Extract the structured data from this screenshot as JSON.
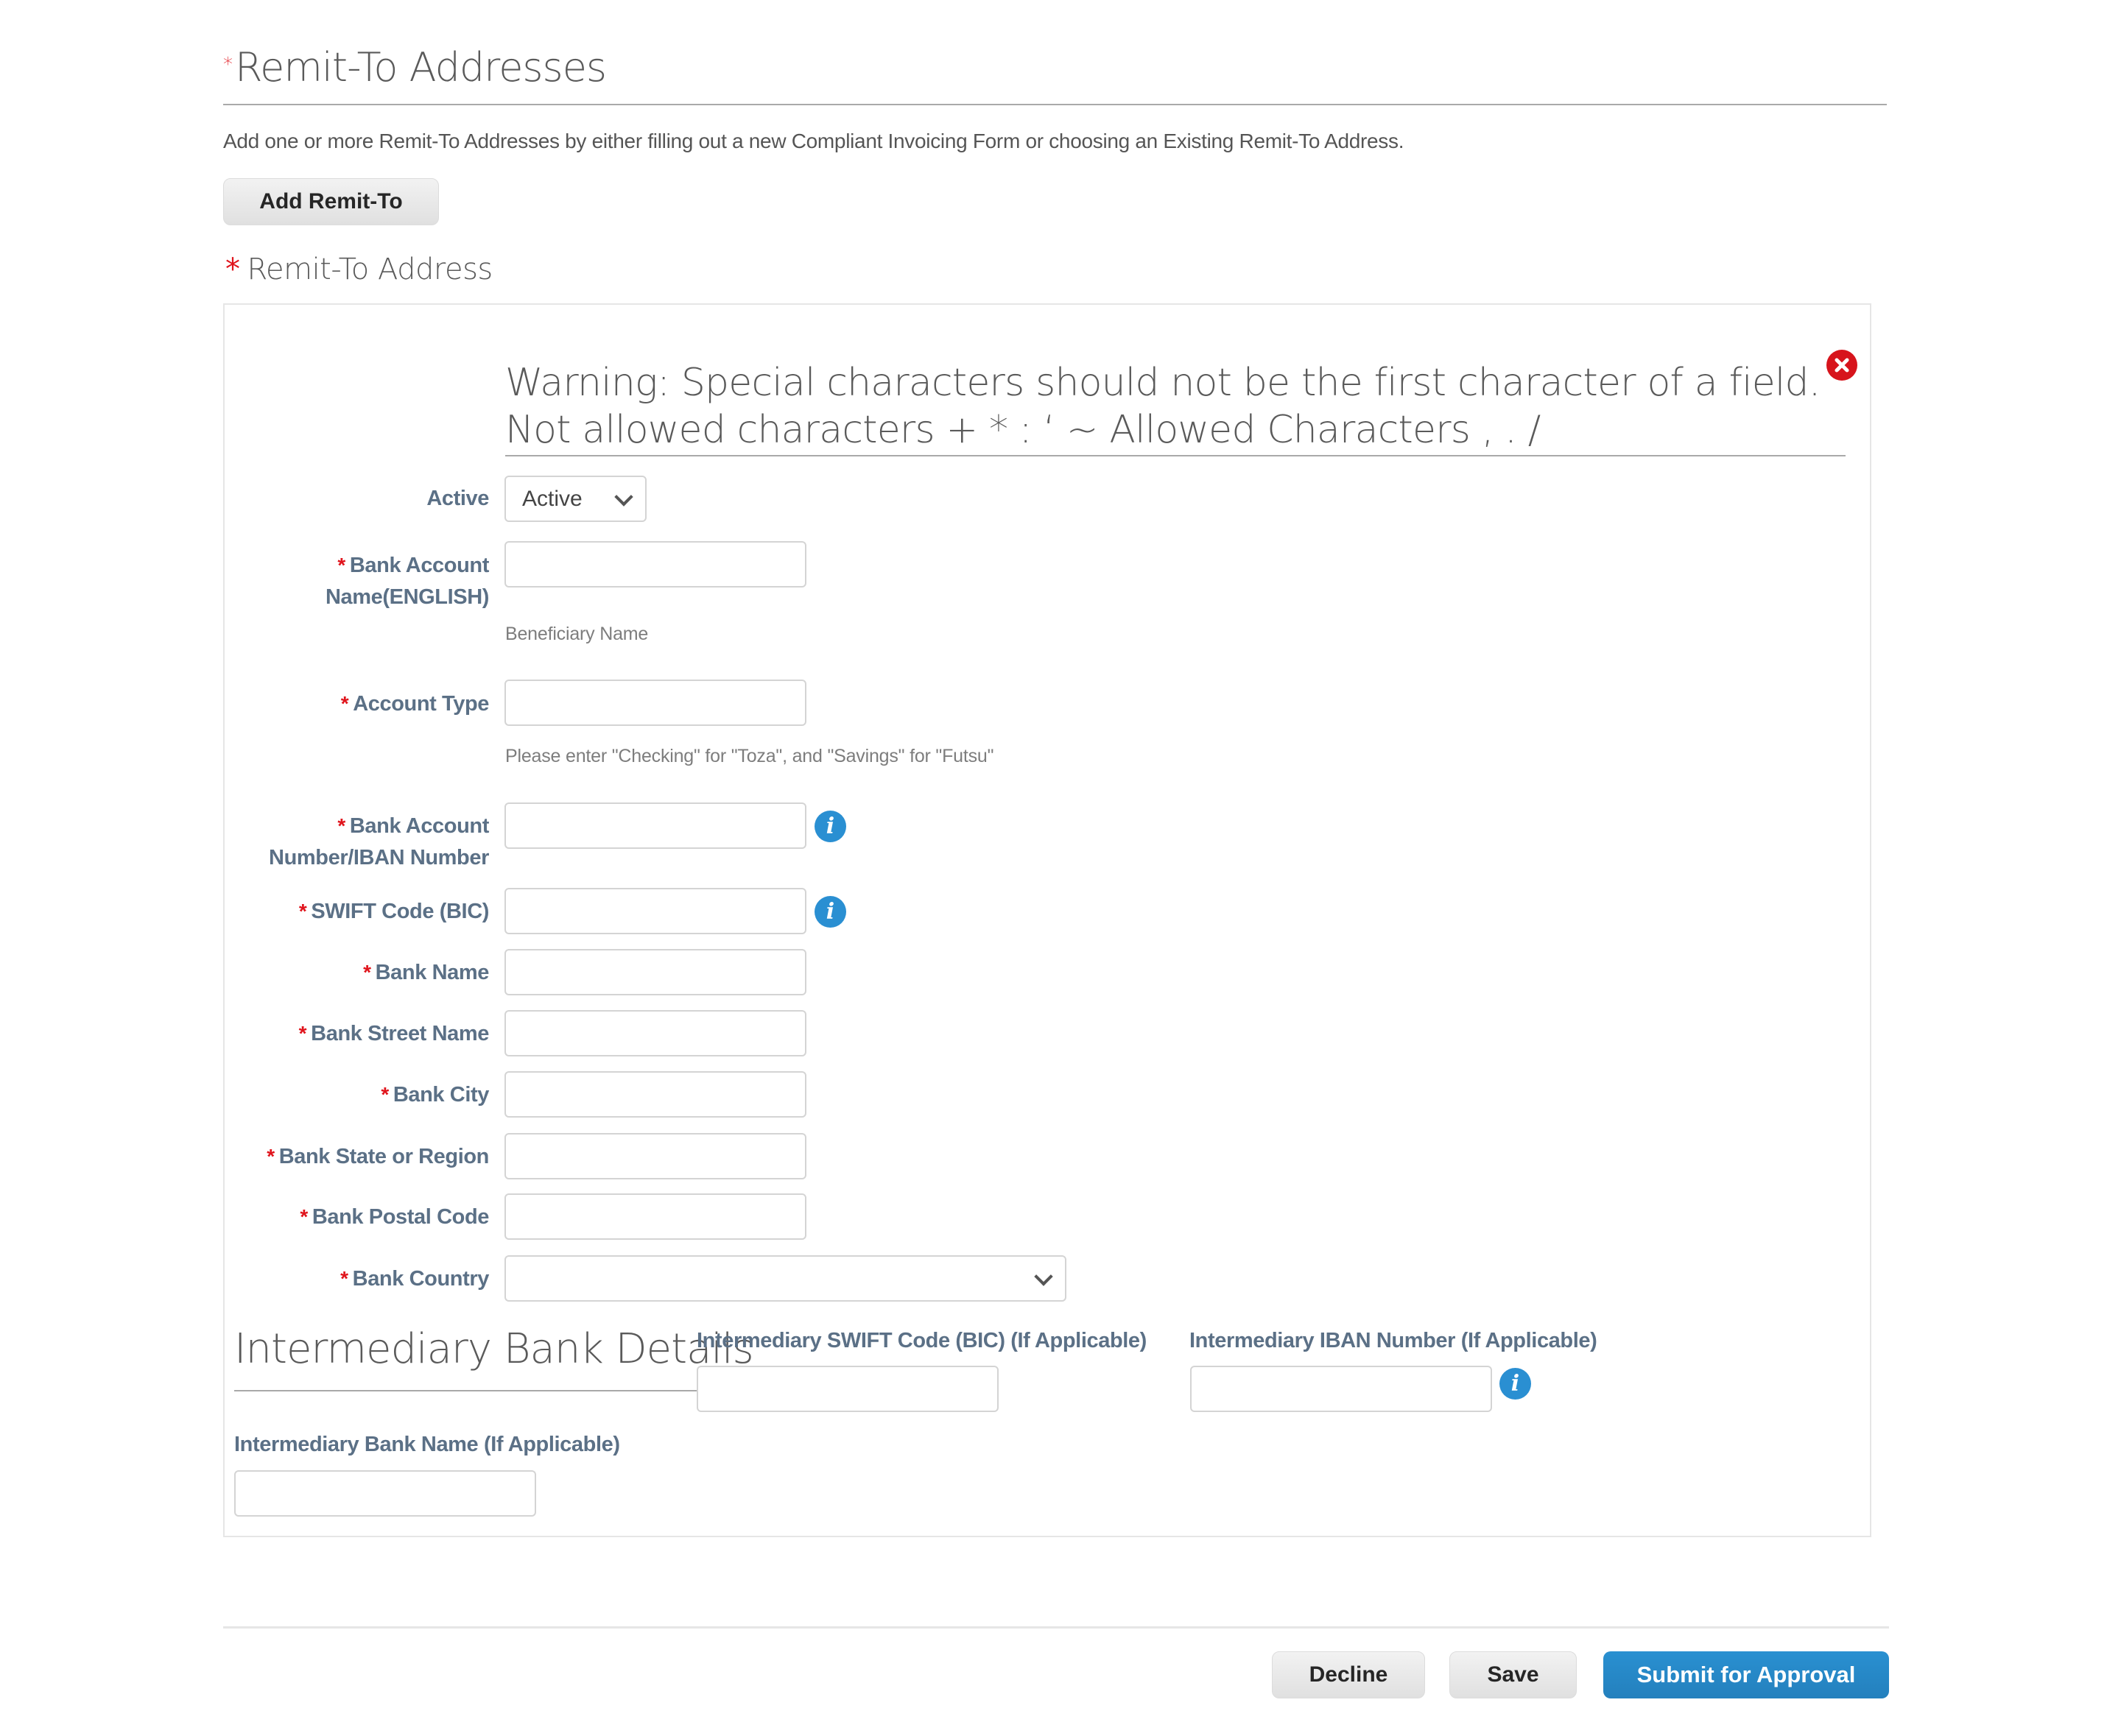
{
  "header": {
    "required_marker": "*",
    "title": "Remit-To Addresses",
    "intro": "Add one or more Remit-To Addresses by either filling out a new Compliant Invoicing Form or choosing an Existing Remit-To Address.",
    "add_button": "Add Remit-To"
  },
  "section": {
    "required_marker": "*",
    "title": "Remit-To Address"
  },
  "warning": {
    "text": "Warning: Special characters should not be the first character of a field. Not allowed characters + * : ‘ ~ Allowed Characters , . /",
    "close_icon": "close-circle-icon"
  },
  "form": {
    "active": {
      "label": "Active",
      "value": "Active"
    },
    "fields": [
      {
        "key": "bank_account_name",
        "required": "*",
        "label_line1": "Bank Account",
        "label_line2": "Name(ENGLISH)",
        "value": "",
        "hint": "Beneficiary Name"
      },
      {
        "key": "account_type",
        "required": "*",
        "label": "Account Type",
        "value": "",
        "hint": "Please enter \"Checking\" for \"Toza\", and \"Savings\" for \"Futsu\""
      },
      {
        "key": "bank_account_number",
        "required": "*",
        "label_line1": "Bank Account",
        "label_line2": "Number/IBAN Number",
        "value": "",
        "info_icon": "info-icon"
      },
      {
        "key": "swift_code",
        "required": "*",
        "label": "SWIFT Code (BIC)",
        "value": "",
        "info_icon": "info-icon"
      },
      {
        "key": "bank_name",
        "required": "*",
        "label": "Bank Name",
        "value": ""
      },
      {
        "key": "bank_street_name",
        "required": "*",
        "label": "Bank Street Name",
        "value": ""
      },
      {
        "key": "bank_city",
        "required": "*",
        "label": "Bank City",
        "value": ""
      },
      {
        "key": "bank_state",
        "required": "*",
        "label": "Bank State or Region",
        "value": ""
      },
      {
        "key": "bank_postal_code",
        "required": "*",
        "label": "Bank Postal Code",
        "value": ""
      },
      {
        "key": "bank_country",
        "required": "*",
        "label": "Bank Country",
        "value": ""
      }
    ],
    "info_glyph": "i"
  },
  "intermediary": {
    "title": "Intermediary Bank Details",
    "swift_label": "Intermediary SWIFT Code (BIC) (If Applicable)",
    "swift_value": "",
    "iban_label": "Intermediary IBAN Number (If Applicable)",
    "iban_value": "",
    "bank_name_label": "Intermediary Bank Name (If Applicable)",
    "bank_name_value": ""
  },
  "footer": {
    "decline": "Decline",
    "save": "Save",
    "submit": "Submit for Approval"
  },
  "colors": {
    "required": "#e0141c",
    "label": "#5b7086",
    "primary": "#2a8fd2",
    "close": "#d7141c"
  }
}
